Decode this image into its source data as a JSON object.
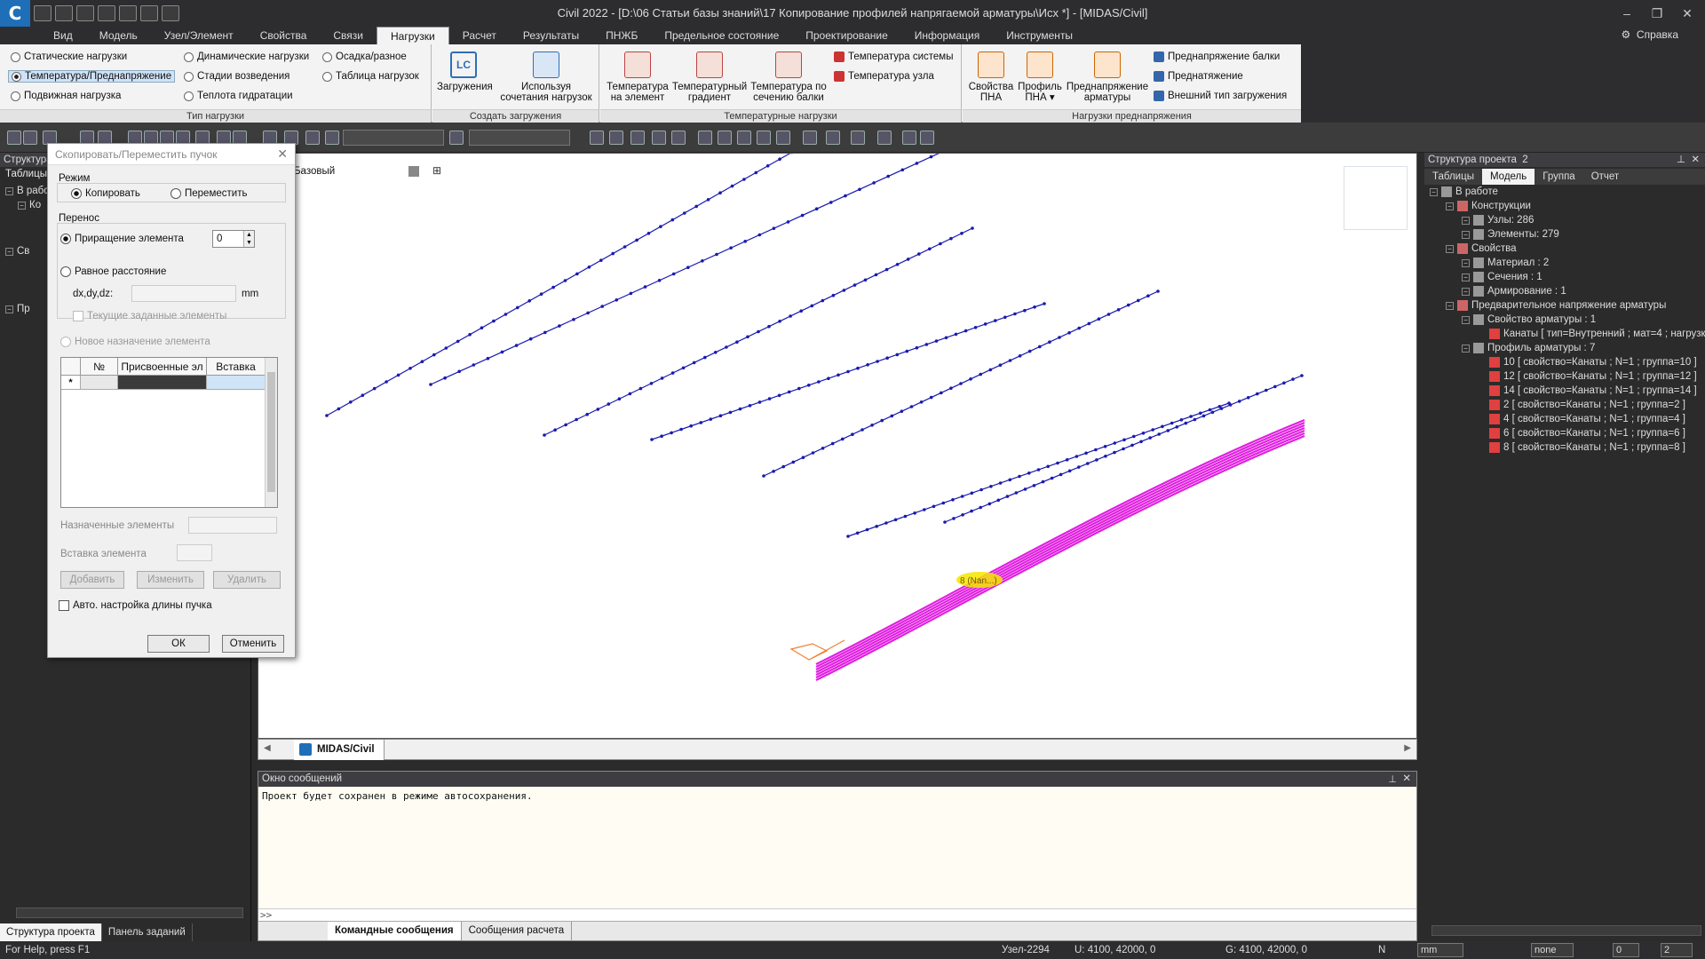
{
  "window": {
    "title": "Civil 2022 - [D:\\06 Статьи базы знаний\\17 Копирование профилей напрягаемой арматуры\\Исх *] - [MIDAS/Civil]",
    "app_logo": "C"
  },
  "menu": {
    "items": [
      "Вид",
      "Модель",
      "Узел/Элемент",
      "Свойства",
      "Связи",
      "Нагрузки",
      "Расчет",
      "Результаты",
      "ПНЖБ",
      "Предельное состояние",
      "Проектирование",
      "Информация",
      "Инструменты"
    ],
    "active": "Нагрузки",
    "help": "Справка"
  },
  "ribbon": {
    "load_type": {
      "label": "Тип нагрузки",
      "options": [
        "Статические нагрузки",
        "Температура/Преднапряжение",
        "Подвижная нагрузка",
        "Динамические нагрузки",
        "Стадии возведения",
        "Теплота гидратации",
        "Осадка/разное",
        "Таблица нагрузок"
      ],
      "selected": "Температура/Преднапряжение"
    },
    "create_loads": {
      "label": "Создать загружения",
      "buttons": [
        {
          "label1": "Загружения",
          "label2": ""
        },
        {
          "label1": "Используя",
          "label2": "сочетания нагрузок"
        }
      ]
    },
    "temperature": {
      "label": "Температурные нагрузки",
      "buttons": [
        {
          "label1": "Температура",
          "label2": "на элемент"
        },
        {
          "label1": "Температурный",
          "label2": "градиент"
        },
        {
          "label1": "Температура по",
          "label2": "сечению балки"
        }
      ],
      "small": [
        "Температура системы",
        "Температура узла"
      ]
    },
    "prestress": {
      "label": "Нагрузки преднапряжения",
      "buttons": [
        {
          "label1": "Свойства",
          "label2": "ПНА"
        },
        {
          "label1": "Профиль",
          "label2": "ПНА ▾"
        },
        {
          "label1": "Преднапряжение",
          "label2": "арматуры"
        }
      ],
      "small": [
        "Преднапряжение балки",
        "Преднатяжение",
        "Внешний тип загружения"
      ]
    }
  },
  "left_panel": {
    "header": "Структура",
    "tab": "Таблицы",
    "tree": [
      "В работе",
      "Ко",
      "Св",
      "Пр"
    ],
    "bottom_tabs": [
      "Структура проекта",
      "Панель заданий"
    ]
  },
  "dialog": {
    "title": "Скопировать/Переместить пучок",
    "mode_label": "Режим",
    "mode_copy": "Копировать",
    "mode_move": "Переместить",
    "transfer_label": "Перенос",
    "increment_label": "Приращение элемента",
    "increment_value": "0",
    "equal_distance": "Равное расстояние",
    "dxdydz_label": "dx,dy,dz:",
    "unit": "mm",
    "current_elements": "Текущие заданные элементы",
    "new_assignment": "Новое назначение элемента",
    "grid_headers": [
      "",
      "№",
      "Присвоенные эл",
      "Вставка"
    ],
    "grid_new_row": "*",
    "assigned_label": "Назначенные элементы",
    "insert_label": "Вставка элемента",
    "btn_add": "Добавить",
    "btn_change": "Изменить",
    "btn_delete": "Удалить",
    "auto_length": "Авто. настройка длины пучка",
    "ok": "ОК",
    "cancel": "Отменить"
  },
  "viewport": {
    "view_label": "Базовый",
    "tab": "MIDAS/Civil",
    "tendon_label": "8 (Nan...)",
    "colors": {
      "beam": "#1a1ab0",
      "tendon": "#e020e0",
      "highlight": "#f5e600",
      "selection": "#f08030"
    }
  },
  "messages": {
    "header": "Окно сообщений",
    "text": "Проект будет сохранен в режиме автосохранения.",
    "prompt": ">>",
    "tabs": [
      "Командные сообщения",
      "Сообщения расчета"
    ]
  },
  "right_panel": {
    "header": "Структура проекта",
    "number": "2",
    "tabs": [
      "Таблицы",
      "Модель",
      "Группа",
      "Отчет"
    ],
    "active_tab": "Модель",
    "tree": [
      {
        "text": "В работе",
        "level": 0
      },
      {
        "text": "Конструкции",
        "level": 1
      },
      {
        "text": "Узлы: 286",
        "level": 2
      },
      {
        "text": "Элементы: 279",
        "level": 2
      },
      {
        "text": "Свойства",
        "level": 1
      },
      {
        "text": "Материал : 2",
        "level": 2
      },
      {
        "text": "Сечения : 1",
        "level": 2
      },
      {
        "text": "Армирование : 1",
        "level": 2
      },
      {
        "text": "Предварительное напряжение арматуры",
        "level": 1
      },
      {
        "text": "Свойство арматуры : 1",
        "level": 2
      },
      {
        "text": "Канаты [ тип=Внутренний ; мат=4 ; нагрузка",
        "level": 3
      },
      {
        "text": "Профиль арматуры : 7",
        "level": 2
      },
      {
        "text": "10 [ свойство=Канаты ; N=1 ; группа=10 ]",
        "level": 3
      },
      {
        "text": "12 [ свойство=Канаты ; N=1 ; группа=12 ]",
        "level": 3
      },
      {
        "text": "14 [ свойство=Канаты ; N=1 ; группа=14 ]",
        "level": 3
      },
      {
        "text": "2 [ свойство=Канаты ; N=1 ; группа=2 ]",
        "level": 3
      },
      {
        "text": "4 [ свойство=Канаты ; N=1 ; группа=4 ]",
        "level": 3
      },
      {
        "text": "6 [ свойство=Канаты ; N=1 ; группа=6 ]",
        "level": 3
      },
      {
        "text": "8 [ свойство=Канаты ; N=1 ; группа=8 ]",
        "level": 3
      }
    ]
  },
  "status": {
    "help": "For Help, press F1",
    "node": "Узел-2294",
    "u": "U: 4100, 42000, 0",
    "g": "G: 4100, 42000, 0",
    "n": "N",
    "unit": "mm",
    "combo": "none",
    "val1": "0",
    "val2": "2"
  }
}
